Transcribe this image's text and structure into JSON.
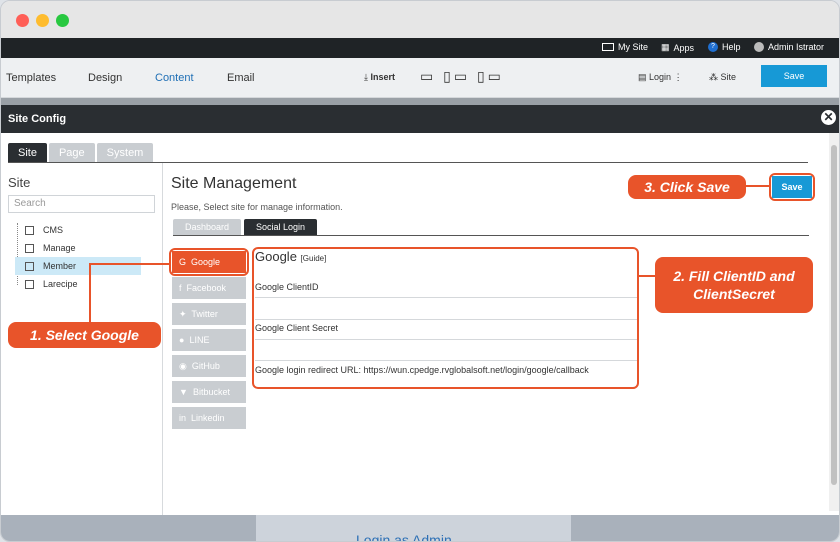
{
  "topbar": {
    "my_site": "My Site",
    "apps": "Apps",
    "help": "Help",
    "user": "Admin Istrator"
  },
  "toolbar": {
    "tabs": [
      "Templates",
      "Design",
      "Content",
      "Email"
    ],
    "insert": "Insert",
    "login": "Login",
    "site": "Site",
    "save": "Save"
  },
  "modal": {
    "title": "Site Config",
    "tabs": [
      "Site",
      "Page",
      "System"
    ]
  },
  "sidebar": {
    "title": "Site",
    "search_placeholder": "Search",
    "items": [
      "CMS",
      "Manage",
      "Member",
      "Larecipe"
    ]
  },
  "main": {
    "title": "Site Management",
    "subtitle": "Please, Select site for manage information.",
    "subtabs": [
      "Dashboard",
      "Social Login"
    ],
    "save": "Save"
  },
  "providers": [
    "Google",
    "Facebook",
    "Twitter",
    "LINE",
    "GitHub",
    "Bitbucket",
    "Linkedin"
  ],
  "form": {
    "title": "Google",
    "guide": "[Guide]",
    "client_id_label": "Google ClientID",
    "client_secret_label": "Google Client Secret",
    "redirect_label": "Google login redirect URL: https://wun.cpedge.rvglobalsoft.net/login/google/callback"
  },
  "callouts": {
    "select": "1. Select Google",
    "fill": "2. Fill ClientID and ClientSecret",
    "save": "3. Click Save"
  },
  "bottom": {
    "link": "Login as Admin"
  },
  "colors": {
    "accent": "#e8542a",
    "primary": "#1799d6"
  }
}
